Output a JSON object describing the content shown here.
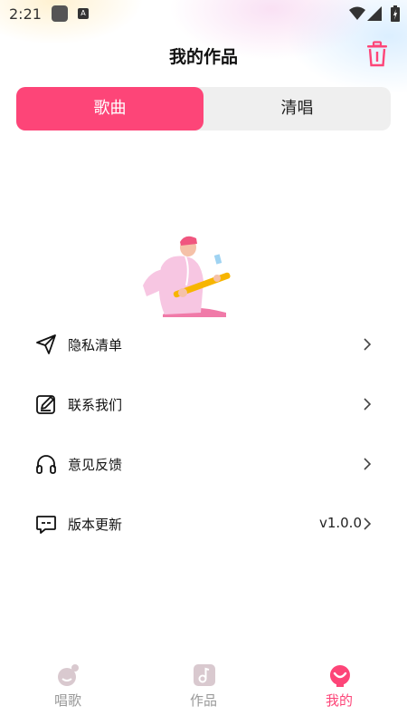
{
  "status_bar": {
    "time": "2:21",
    "app_badge": "A"
  },
  "header": {
    "title": "我的作品",
    "delete_icon": "trash-icon"
  },
  "tabs": [
    {
      "label": "歌曲",
      "selected": true
    },
    {
      "label": "清唱",
      "selected": false
    }
  ],
  "menu": {
    "items": [
      {
        "label": "隐私清单",
        "icon": "send-icon",
        "value": ""
      },
      {
        "label": "联系我们",
        "icon": "edit-icon",
        "value": ""
      },
      {
        "label": "意见反馈",
        "icon": "headphones-icon",
        "value": ""
      },
      {
        "label": "版本更新",
        "icon": "message-icon",
        "value": "v1.0.0"
      }
    ]
  },
  "bottom_nav": [
    {
      "label": "唱歌",
      "icon": "sing-icon",
      "active": false
    },
    {
      "label": "作品",
      "icon": "music-note-icon",
      "active": false
    },
    {
      "label": "我的",
      "icon": "profile-icon",
      "active": true
    }
  ],
  "colors": {
    "accent": "#fd4578",
    "inactive": "#999999",
    "tab_bg": "#efefef"
  }
}
